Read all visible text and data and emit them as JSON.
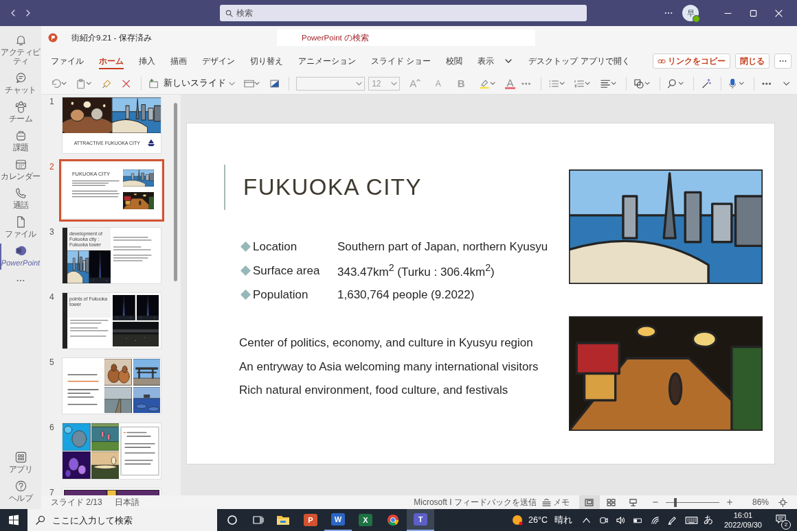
{
  "title_bar": {
    "search_placeholder": "検索",
    "avatar_initial": "早"
  },
  "rail": {
    "items": [
      {
        "label": "アクティビティ",
        "kind": "activity",
        "selected": false
      },
      {
        "label": "チャット",
        "kind": "chat",
        "selected": false
      },
      {
        "label": "チーム",
        "kind": "teams",
        "selected": false
      },
      {
        "label": "課題",
        "kind": "assignments",
        "selected": false
      },
      {
        "label": "カレンダー",
        "kind": "calendar",
        "selected": false
      },
      {
        "label": "通話",
        "kind": "calls",
        "selected": false
      },
      {
        "label": "ファイル",
        "kind": "files",
        "selected": false
      },
      {
        "label": "PowerPoint",
        "kind": "powerpoint",
        "selected": true
      }
    ],
    "bottom": [
      {
        "label": "アプリ",
        "kind": "apps"
      },
      {
        "label": "ヘルプ",
        "kind": "help"
      }
    ]
  },
  "document": {
    "title": "街紹介9.21 - 保存済み",
    "search_placeholder": "PowerPoint の検索"
  },
  "ribbon": {
    "tabs": [
      {
        "label": "ファイル",
        "selected": false
      },
      {
        "label": "ホーム",
        "selected": true
      },
      {
        "label": "挿入",
        "selected": false
      },
      {
        "label": "描画",
        "selected": false
      },
      {
        "label": "デザイン",
        "selected": false
      },
      {
        "label": "切り替え",
        "selected": false
      },
      {
        "label": "アニメーション",
        "selected": false
      },
      {
        "label": "スライド ショー",
        "selected": false
      },
      {
        "label": "校閲",
        "selected": false
      },
      {
        "label": "表示",
        "selected": false
      }
    ],
    "open_desktop": "デスクトップ アプリで開く",
    "copy_link": "リンクをコピー",
    "close": "閉じる"
  },
  "toolbar": {
    "new_slide": "新しいスライド",
    "font_size": "12",
    "glyphs": [
      {
        "label": "A",
        "kind": "grow"
      },
      {
        "label": "A",
        "kind": "shrink"
      },
      {
        "label": "B",
        "kind": "bold"
      },
      {
        "label": "A",
        "kind": "font_color"
      }
    ]
  },
  "thumbnails": [
    {
      "number": "1",
      "kind": "cover",
      "selected": false,
      "title": "ATTRACTIVE FUKUOKA CITY"
    },
    {
      "number": "2",
      "kind": "content",
      "selected": true,
      "title": "FUKUOKA CITY"
    },
    {
      "number": "3",
      "kind": "tower",
      "selected": false,
      "title": "development of Fukuoka city : Fukuoka tower"
    },
    {
      "number": "4",
      "kind": "night",
      "selected": false,
      "title": "points of Fukuoka tower"
    },
    {
      "number": "5",
      "kind": "gallery",
      "selected": false
    },
    {
      "number": "6",
      "kind": "collage",
      "selected": false
    },
    {
      "number": "7",
      "kind": "strip",
      "selected": false
    }
  ],
  "slide": {
    "title": "FUKUOKA CITY",
    "facts": [
      {
        "label": "Location",
        "value": "Southern part of Japan, northern Kyusyu"
      },
      {
        "label": "Surface area",
        "value": "343.47km$^{2}$  (Turku : 306.4km$^{2}$)"
      },
      {
        "label": "Population",
        "value": "1,630,764 people (9.2022)"
      }
    ],
    "points": [
      "Center of politics, economy, and culture in Kyusyu region",
      "An entryway to Asia welcoming many international visitors",
      "Rich natural environment, food culture, and festivals"
    ]
  },
  "status_bar": {
    "slide_count": "スライド 2/13",
    "language": "日本語",
    "feedback": "Microsoft I フィードバックを送信",
    "notes": "メモ",
    "views": [
      {
        "kind": "normal",
        "selected": true
      },
      {
        "kind": "sorter",
        "selected": false
      },
      {
        "kind": "presenter",
        "selected": false
      }
    ],
    "zoom": {
      "level": 0.18,
      "reading": "86%"
    }
  },
  "taskbar": {
    "search_placeholder": "ここに入力して検索",
    "apps": [
      {
        "kind": "explorer",
        "selected": false,
        "running": false
      },
      {
        "kind": "powerpoint",
        "letter": "P",
        "selected": false,
        "running": false
      },
      {
        "kind": "word",
        "letter": "W",
        "selected": false,
        "running": true
      },
      {
        "kind": "excel",
        "letter": "X",
        "selected": false,
        "running": false
      },
      {
        "kind": "chrome",
        "selected": false,
        "running": false
      },
      {
        "kind": "teams",
        "letter": "T",
        "selected": true,
        "running": true
      }
    ],
    "temperature": "26°C",
    "weather": "晴れ",
    "ime": "あ",
    "time": "16:01",
    "date": "2022/09/30",
    "notifications": "2"
  }
}
